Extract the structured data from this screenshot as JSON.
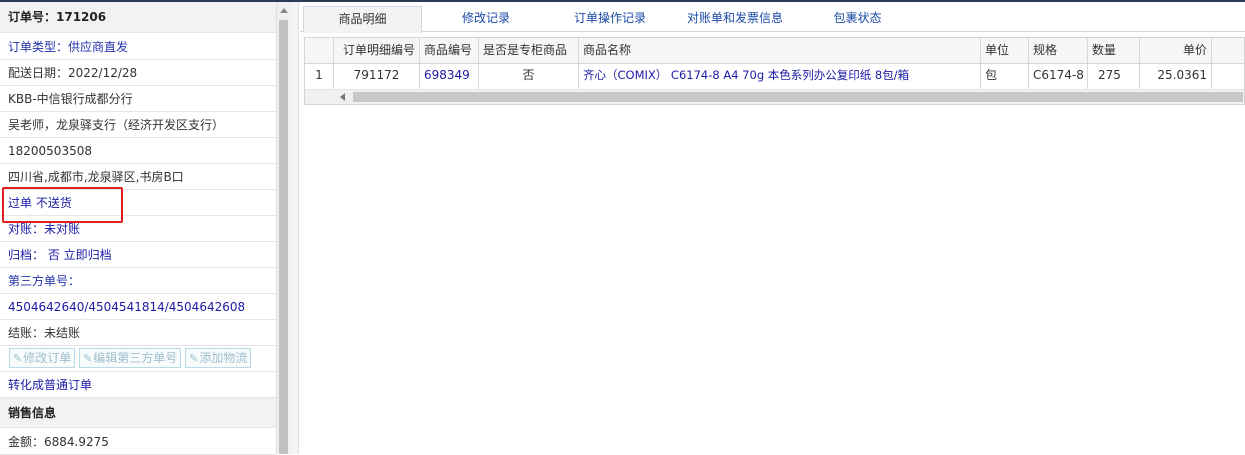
{
  "order": {
    "number_label": "订单号：171206",
    "type": "订单类型：供应商直发",
    "delivery_date": "配送日期：2022/12/28",
    "customer": "KBB-中信银行成都分行",
    "contact": "吴老师，龙泉驿支行（经济开发区支行）",
    "phone": "18200503508",
    "address": "四川省,成都市,龙泉驿区,书房B口",
    "flags": "过单 不送货",
    "reconcile": "对账：未对账",
    "archive": "归档：  否 立即归档",
    "third_party_label": "第三方单号：",
    "third_party_value": "4504642640/4504541814/4504642608",
    "settlement": "结账：未结账",
    "buttons": [
      "修改订单",
      "编辑第三方单号",
      "添加物流"
    ],
    "convert_link": "转化成普通订单"
  },
  "sales": {
    "header": "销售信息",
    "amount": "金额：6884.9275"
  },
  "tabs": [
    "商品明细",
    "修改记录",
    "订单操作记录",
    "对账单和发票信息",
    "包裹状态"
  ],
  "grid": {
    "columns": [
      "",
      "订单明细编号",
      "商品编号",
      "是否是专柜商品",
      "商品名称",
      "单位",
      "规格",
      "数量",
      "单价"
    ],
    "rows": [
      [
        "1",
        "791172",
        "698349",
        "否",
        "齐心（COMIX） C6174-8 A4 70g 本色系列办公复印纸 8包/箱",
        "包",
        "C6174-8",
        "275",
        "25.0361"
      ]
    ]
  },
  "icons": {
    "edit": "edit-icon",
    "scroll_up": "arrow-up-icon",
    "scroll_left": "arrow-left-icon"
  },
  "colors": {
    "highlight_box": "#e02020",
    "link_blue": "#1a1aa6",
    "disabled_button": "#9fbfcc"
  }
}
